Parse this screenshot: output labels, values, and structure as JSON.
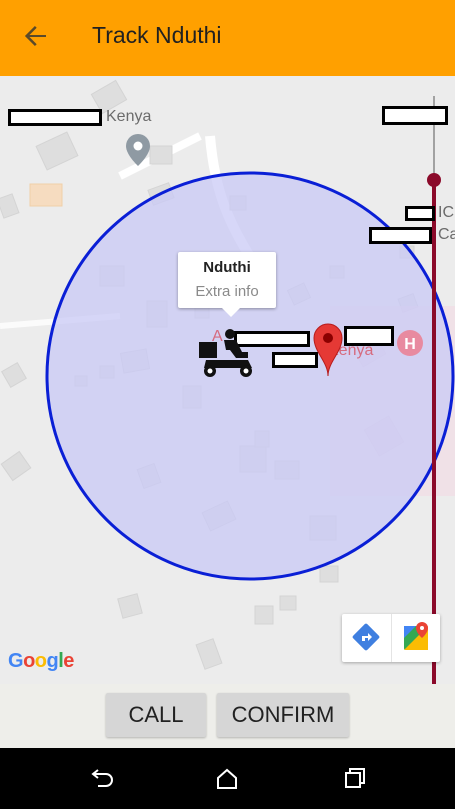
{
  "appbar": {
    "title": "Track Nduthi",
    "back_icon": "arrow-back-icon",
    "background": "#ffa000"
  },
  "map": {
    "labels": {
      "kenya_top": "Kenya",
      "kenya_poi": "i Kenya",
      "poi_a": "A",
      "ic_1": "IC",
      "ic_2": "Ca"
    },
    "info_window": {
      "title": "Nduthi",
      "subtitle": "Extra info"
    },
    "circle_stroke": "#0a1fd6",
    "circle_fill": "#c9c9f5",
    "route_color": "#8b0a2a",
    "marker_color": "#e53935",
    "google_logo": "Google"
  },
  "actions": {
    "call_label": "CALL",
    "confirm_label": "CONFIRM"
  },
  "navbar": {
    "back_icon": "nav-back-icon",
    "home_icon": "nav-home-icon",
    "recents_icon": "nav-recents-icon"
  }
}
